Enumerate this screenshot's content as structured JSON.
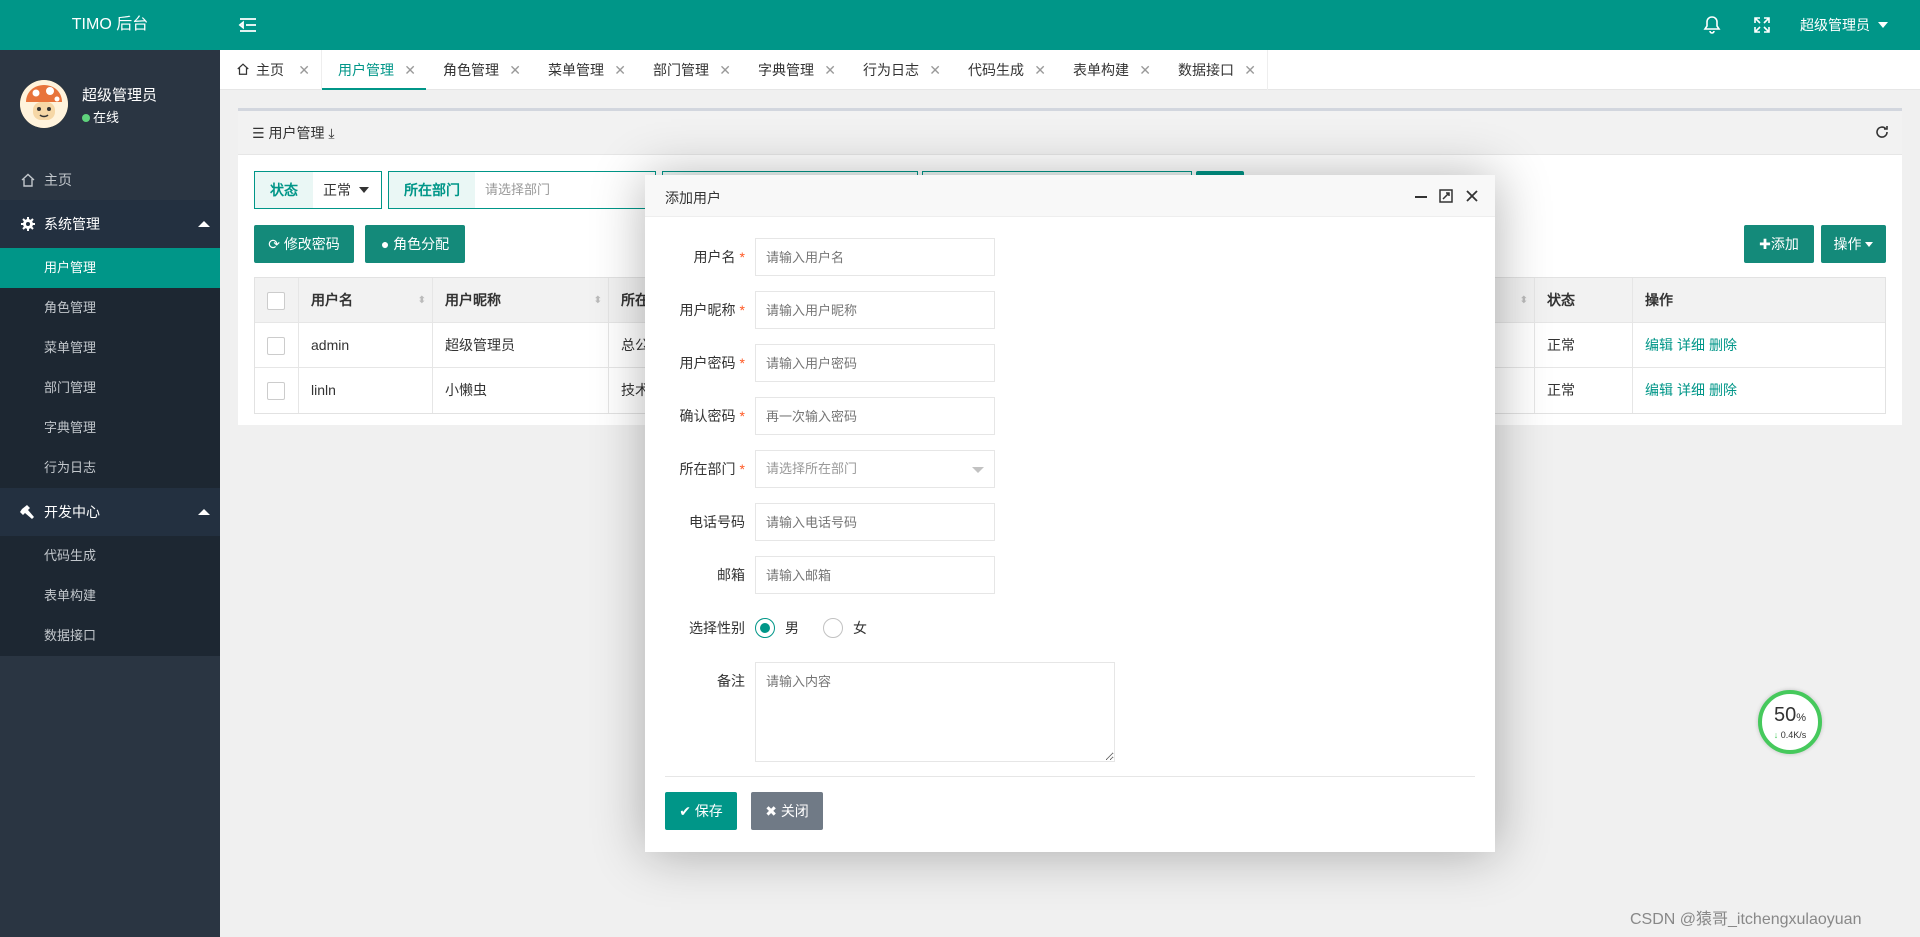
{
  "header": {
    "brand": "TIMO 后台",
    "user_label": "超级管理员"
  },
  "sidebar": {
    "profile_name": "超级管理员",
    "profile_status": "在线",
    "home": "主页",
    "groups": [
      {
        "label": "系统管理",
        "items": [
          "用户管理",
          "角色管理",
          "菜单管理",
          "部门管理",
          "字典管理",
          "行为日志"
        ]
      },
      {
        "label": "开发中心",
        "items": [
          "代码生成",
          "表单构建",
          "数据接口"
        ]
      }
    ]
  },
  "tabs": [
    "主页",
    "用户管理",
    "角色管理",
    "菜单管理",
    "部门管理",
    "字典管理",
    "行为日志",
    "代码生成",
    "表单构建",
    "数据接口"
  ],
  "panel": {
    "title": "用户管理"
  },
  "filters": {
    "status_label": "状态",
    "status_value": "正常",
    "dept_label": "所在部门",
    "dept_placeholder": "请选择部门"
  },
  "toolbar": {
    "change_password": "修改密码",
    "role_assign": "角色分配",
    "add": "添加",
    "ops": "操作"
  },
  "table": {
    "columns": [
      "用户名",
      "用户昵称",
      "所在",
      "状态",
      "操作"
    ],
    "rows": [
      {
        "username": "admin",
        "nickname": "超级管理员",
        "dept": "总公",
        "status": "正常"
      },
      {
        "username": "linln",
        "nickname": "小懒虫",
        "dept": "技术",
        "status": "正常"
      }
    ],
    "actions": [
      "编辑",
      "详细",
      "删除"
    ]
  },
  "modal": {
    "title": "添加用户",
    "fields": [
      {
        "label": "用户名",
        "placeholder": "请输入用户名",
        "required": true
      },
      {
        "label": "用户昵称",
        "placeholder": "请输入用户昵称",
        "required": true
      },
      {
        "label": "用户密码",
        "placeholder": "请输入用户密码",
        "required": true
      },
      {
        "label": "确认密码",
        "placeholder": "再一次输入密码",
        "required": true
      },
      {
        "label": "所在部门",
        "placeholder": "请选择所在部门",
        "required": true
      },
      {
        "label": "电话号码",
        "placeholder": "请输入电话号码",
        "required": false
      },
      {
        "label": "邮箱",
        "placeholder": "请输入邮箱",
        "required": false
      }
    ],
    "gender_label": "选择性别",
    "gender_male": "男",
    "gender_female": "女",
    "remark_label": "备注",
    "remark_placeholder": "请输入内容",
    "save": "保存",
    "close": "关闭",
    "required_mark": "*"
  },
  "speed_widget": {
    "percent": "50",
    "unit": "%",
    "rate": "0.4K/s"
  },
  "watermark": "CSDN @猿哥_itchengxulaoyuan",
  "colors": {
    "primary": "#009688",
    "sidebar_bg": "#2a3542",
    "required": "#ff5722"
  }
}
